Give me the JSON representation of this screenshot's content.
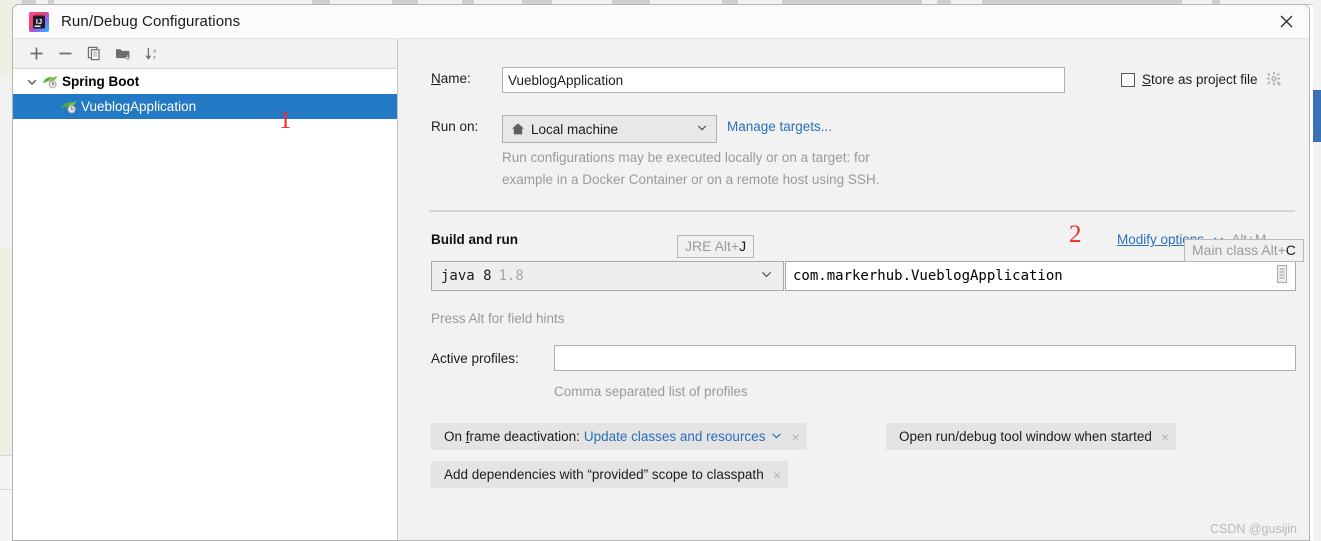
{
  "window": {
    "title": "Run/Debug Configurations",
    "app_icon": "intellij-idea-icon",
    "close_label": "×"
  },
  "background": {
    "strip_color": "#eeeee4",
    "accent_blue": "#3b6fb6"
  },
  "left_panel": {
    "toolbar": [
      {
        "name": "add-configuration-button",
        "icon": "plus-icon",
        "tooltip_label": "Add New Configuration"
      },
      {
        "name": "remove-configuration-button",
        "icon": "minus-icon",
        "tooltip_label": "Remove Configuration"
      },
      {
        "name": "copy-configuration-button",
        "icon": "copy-icon",
        "tooltip_label": "Copy Configuration"
      },
      {
        "name": "move-into-folder-button",
        "icon": "folder-add-icon",
        "tooltip_label": "Move into new folder / Create new folder"
      },
      {
        "name": "sort-configurations-button",
        "icon": "sort-alphabetically-icon",
        "tooltip_label": "Sort Configurations"
      }
    ],
    "tree": [
      {
        "label": "Spring Boot",
        "icon": "spring-boot-icon",
        "expanded": true,
        "selected": false,
        "children": [
          {
            "label": "VueblogApplication",
            "icon": "spring-boot-icon",
            "selected": true
          }
        ]
      }
    ]
  },
  "config": {
    "name_label": "Name:",
    "name_mnemonic": "N",
    "name_value": "VueblogApplication",
    "run_on_label": "Run on:",
    "run_on_value": "Local machine",
    "run_on_icon": "home-icon",
    "manage_targets_link": "Manage targets...",
    "run_on_hint_line1": "Run configurations may be executed locally or on a target: for",
    "run_on_hint_line2": "example in a Docker Container or on a remote host using SSH.",
    "store_as_project_file_label": "Store as project file",
    "store_as_project_file_mnemonic": "S",
    "store_as_project_file_checked": false,
    "store_gear_icon": "gear-dropdown-icon",
    "build_and_run_title": "Build and run",
    "modify_options_link": "Modify options",
    "modify_options_mnemonic": "M",
    "modify_options_shortcut": "Alt+M",
    "jre_value": "java 8",
    "jre_version": "1.8",
    "jre_tooltip_text": "JRE Alt+",
    "jre_tooltip_key": "J",
    "main_class_value": "com.markerhub.VueblogApplication",
    "main_class_tooltip_text": "Main class Alt+",
    "main_class_tooltip_key": "C",
    "main_class_browse_icon": "browse-class-icon",
    "field_hints_text": "Press Alt for field hints",
    "active_profiles_label": "Active profiles:",
    "active_profiles_value": "",
    "active_profiles_hint": "Comma separated list of profiles",
    "chips": [
      {
        "name": "chip-on-frame-deactivation",
        "label": "On frame deactivation:",
        "mnemonic": "f",
        "value": "Update classes and resources",
        "has_chevron": true,
        "close": "×"
      },
      {
        "name": "chip-open-tool-window",
        "label": "Open run/debug tool window when started",
        "value": "",
        "has_chevron": false,
        "close": "×"
      },
      {
        "name": "chip-add-provided-scope",
        "label": "Add dependencies with “provided” scope to classpath",
        "value": "",
        "has_chevron": false,
        "close": "×"
      }
    ]
  },
  "annotations": [
    {
      "name": "annotation-1",
      "label": "1",
      "color": "#ee2b2b"
    },
    {
      "name": "annotation-2",
      "label": "2",
      "color": "#ee2b2b"
    }
  ],
  "watermark": "CSDN @gusijin"
}
